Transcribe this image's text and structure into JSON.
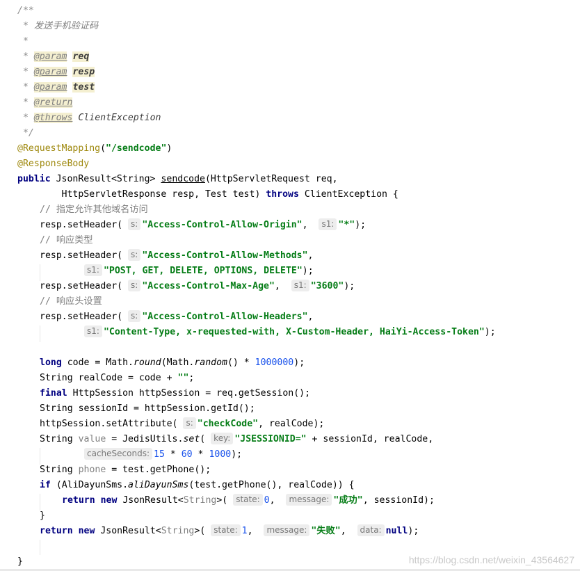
{
  "doc": {
    "open": "/**",
    "star": " *",
    "desc": "发送手机验证码",
    "tag_param": "@param",
    "tag_return": "@return",
    "tag_throws": "@throws",
    "p_req": "req",
    "p_resp": "resp",
    "p_test": "test",
    "throws_type": "ClientException",
    "close": " */"
  },
  "annotations": {
    "mapping_name": "@RequestMapping",
    "mapping_open": "(",
    "mapping_value": "\"/sendcode\"",
    "mapping_close": ")",
    "body": "@ResponseBody"
  },
  "signature": {
    "kw_public": "public",
    "ret_type": " JsonResult<String> ",
    "method": "sendcode",
    "params1": "(HttpServletRequest req,",
    "params2": "        HttpServletResponse resp, Test test) ",
    "kw_throws": "throws",
    "after": " ClientException {"
  },
  "comments": {
    "cors": "// 指定允许其他域名访问",
    "type": "// 响应类型",
    "headers": "// 响应头设置"
  },
  "code": {
    "set_header": "resp.setHeader(",
    "h_origin": "\"Access-Control-Allow-Origin\"",
    "v_origin": "\"*\"",
    "h_methods": "\"Access-Control-Allow-Methods\"",
    "v_methods": "\"POST, GET, DELETE, OPTIONS, DELETE\"",
    "h_maxage": "\"Access-Control-Max-Age\"",
    "v_maxage": "\"3600\"",
    "h_allow": "\"Access-Control-Allow-Headers\"",
    "v_allow": "\"Content-Type, x-requested-with, X-Custom-Header, HaiYi-Access-Token\"",
    "kw_long": "long",
    "code_assign": " code = Math.",
    "round": "round",
    "math_open": "(Math.",
    "random": "random",
    "times_space": "() * ",
    "million": "1000000",
    "close_semi": ");",
    "realcode_line": "String realCode = code + ",
    "empty_str": "\"\"",
    "semi": ";",
    "kw_final": "final",
    "httpsession_line": " HttpSession httpSession = req.getSession();",
    "sessionid_line": "String sessionId = httpSession.getId();",
    "setattr_open": "httpSession.setAttribute(",
    "check_code": "\"checkCode\"",
    "realcode_close": ", realCode);",
    "string_kw": "String ",
    "value_var": "value",
    "jedis_open": " = JedisUtils.",
    "set_fn": "set",
    "paren_open": "(",
    "jsession": "\"JSESSIONID=\"",
    "plus_session": " + sessionId, realCode,",
    "n15": "15",
    "times": " * ",
    "n60": "60",
    "n1000": "1000",
    "phone_var": "phone",
    "phone_assign": " = test.getPhone();",
    "kw_if": "if",
    "if_open": " (AliDayunSms.",
    "ali_fn": "aliDayunSms",
    "if_args": "(test.getPhone(), realCode)) {",
    "kw_return": "return",
    "kw_new": "new",
    "json_result": " JsonResult<",
    "generic_string": "String",
    "generic_close": ">(",
    "n0": "0",
    "comma": ", ",
    "success": "\"成功\"",
    "session_close": ", sessionId);",
    "brace_close": "}",
    "n1": "1",
    "fail": "\"失败\"",
    "kw_null": "null"
  },
  "hints": {
    "s": "s:",
    "s1": "s1:",
    "key": "key:",
    "cache_seconds": "cacheSeconds:",
    "state": "state:",
    "message": "message:",
    "data": "data:"
  },
  "watermark": "https://blog.csdn.net/weixin_43564627"
}
